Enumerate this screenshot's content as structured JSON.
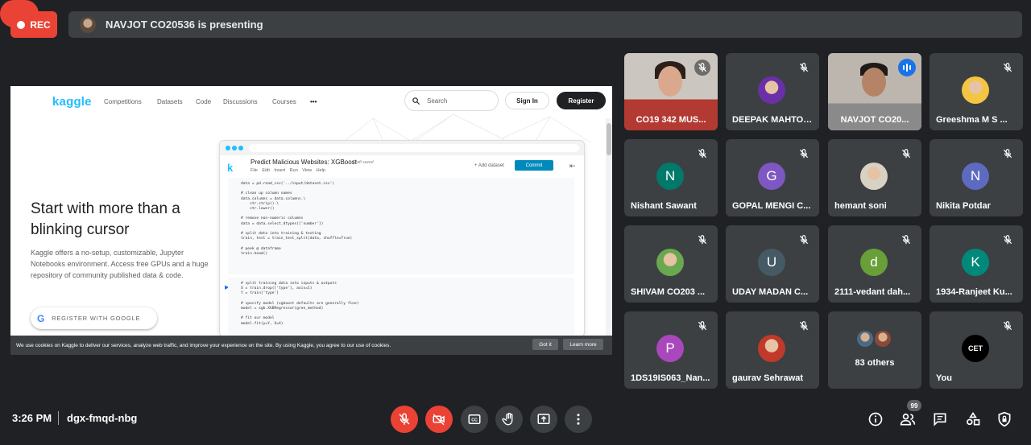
{
  "recording": {
    "label": "REC"
  },
  "presenter_bar": {
    "text": "NAVJOT CO20536 is presenting"
  },
  "shared_screen": {
    "logo": "kaggle",
    "nav": [
      "Competitions",
      "Datasets",
      "Code",
      "Discussions",
      "Courses",
      "•••"
    ],
    "search_placeholder": "Search",
    "signin": "Sign In",
    "register": "Register",
    "headline": "Start with more than a blinking cursor",
    "subtext": "Kaggle offers a no-setup, customizable, Jupyter Notebooks environment. Access free GPUs and a huge repository of community published data & code.",
    "google_button": "REGISTER WITH GOOGLE",
    "notebook": {
      "title": "Predict Malicious Websites: XGBoost",
      "draft": "Draft saved",
      "menu": "File Edit Insert Run View Help",
      "add_dataset": "+ Add dataset",
      "commit": "Commit",
      "code1": "data = pd.read_csv('../input/dataset.csv')\n\n# clean up column names\ndata.columns = data.columns.\\\n    str.strip().\\\n    str.lower()\n\n# remove non-numeric columns\ndata = data.select_dtypes(['number'])\n\n# split data into training & testing\ntrain, test = train_test_split(data, shuffle=True)\n\n# peek @ dataframe\ntrain.head()",
      "code2": "# split training data into inputs & outputs\nX = train.drop(['type'], axis=1)\nY = train['type']\n\n# specify model (xgboost defaults are generally fine)\nmodel = xgb.XGBRegressor(gree_method)\n\n# fit our model\nmodel.fit(y=Y, X=X)"
    },
    "cookie": {
      "text": "We use cookies on Kaggle to deliver our services, analyze web traffic, and improve your experience on the site. By using Kaggle, you agree to our use of cookies.",
      "got_it": "Got it",
      "learn_more": "Learn more"
    }
  },
  "participants": [
    {
      "name": "CO19 342 MUS...",
      "type": "video1"
    },
    {
      "name": "DEEPAK MAHTO ...",
      "type": "photo",
      "color": "#6b2fa8"
    },
    {
      "name": "NAVJOT CO20...",
      "type": "video2"
    },
    {
      "name": "Greeshma M S ...",
      "type": "photo",
      "color": "#f4c542"
    },
    {
      "name": "Nishant Sawant",
      "type": "letter",
      "letter": "N",
      "color": "#00796b"
    },
    {
      "name": "GOPAL MENGI C...",
      "type": "letter",
      "letter": "G",
      "color": "#7e57c2"
    },
    {
      "name": "hemant soni",
      "type": "photo",
      "color": "#d8d2c4"
    },
    {
      "name": "Nikita Potdar",
      "type": "letter",
      "letter": "N",
      "color": "#5c6bc0"
    },
    {
      "name": "SHIVAM CO203 ...",
      "type": "photo",
      "color": "#6aa84f"
    },
    {
      "name": "UDAY MADAN C...",
      "type": "letter",
      "letter": "U",
      "color": "#455a64"
    },
    {
      "name": "2111-vedant dah...",
      "type": "letter",
      "letter": "d",
      "color": "#689f38"
    },
    {
      "name": "1934-Ranjeet Ku...",
      "type": "letter",
      "letter": "K",
      "color": "#00897b"
    },
    {
      "name": "1DS19IS063_Nan...",
      "type": "letter",
      "letter": "P",
      "color": "#ab47bc"
    },
    {
      "name": "gaurav Sehrawat",
      "type": "photo",
      "color": "#c0392b"
    },
    {
      "name": "83 others",
      "type": "others"
    },
    {
      "name": "You",
      "type": "logo",
      "logo_text": "CET"
    }
  ],
  "bottom_bar": {
    "time": "3:26 PM",
    "meeting_code": "dgx-fmqd-nbg",
    "participants_count": "99"
  }
}
